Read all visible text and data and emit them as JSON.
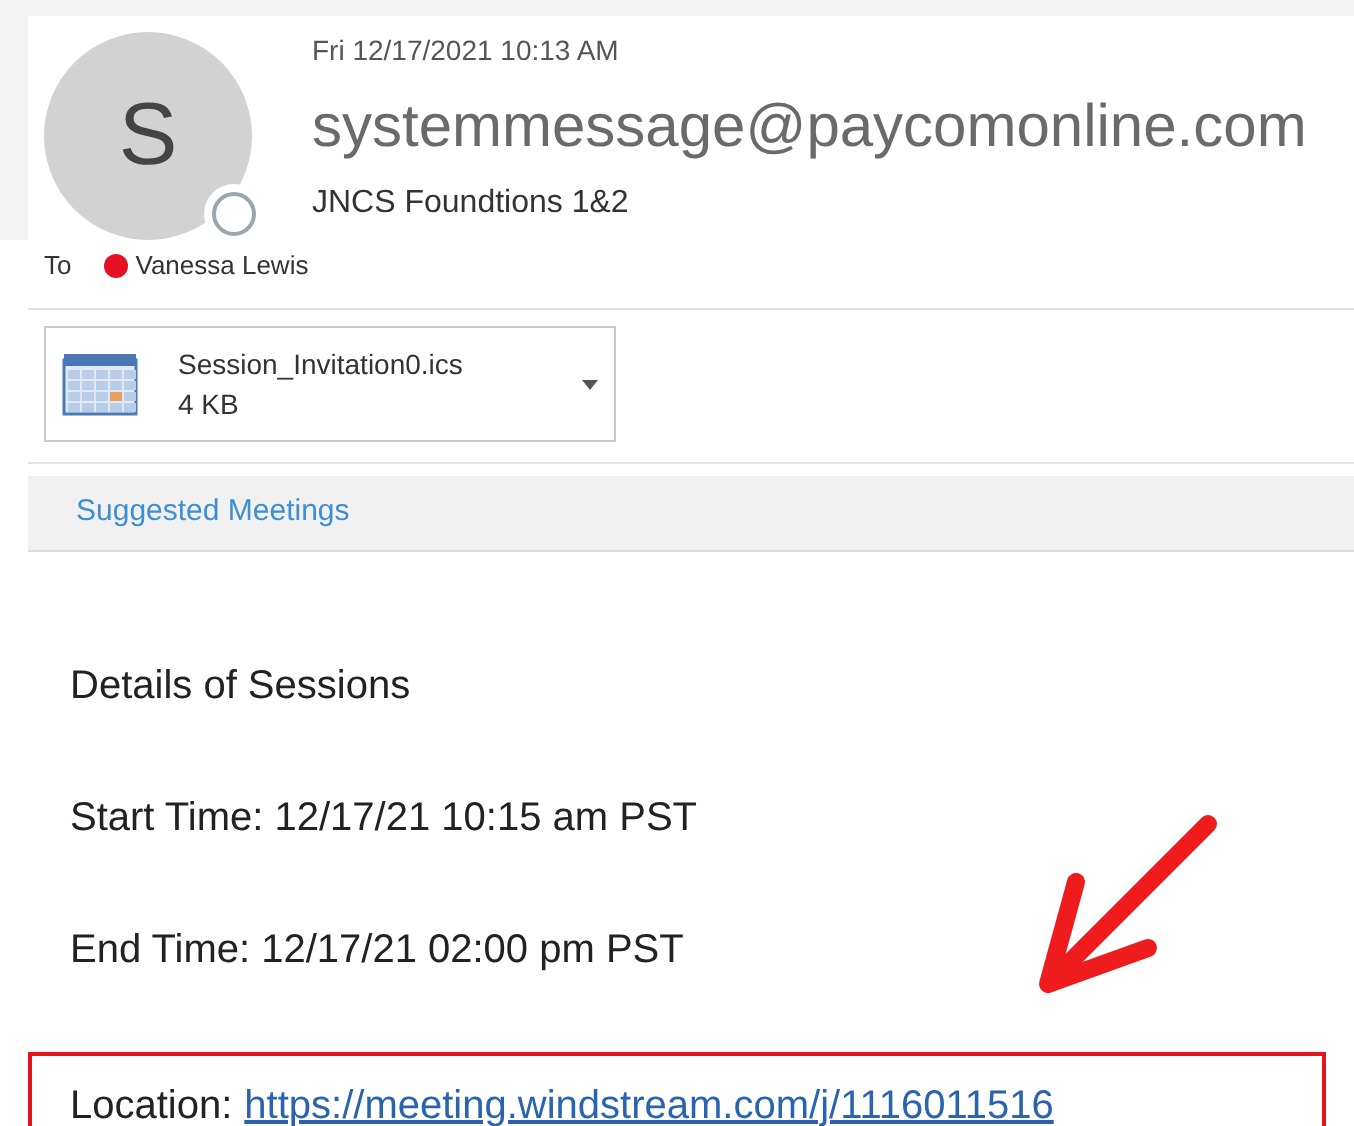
{
  "message": {
    "date": "Fri 12/17/2021 10:13 AM",
    "sender_initial": "S",
    "sender": "systemmessage@paycomonline.com",
    "subject": "JNCS Foundtions 1&2",
    "to_label": "To",
    "recipients": [
      {
        "name": "Vanessa Lewis",
        "color": "#e81123"
      }
    ]
  },
  "attachments": [
    {
      "name": "Session_Invitation0.ics",
      "size": "4 KB"
    }
  ],
  "suggested_meetings": "Suggested Meetings",
  "body": [
    {
      "kind": "text",
      "text": "Details of Sessions",
      "highlighted": false
    },
    {
      "kind": "text",
      "text": "Start Time: 12/17/21 10:15 am PST",
      "highlighted": false
    },
    {
      "kind": "text",
      "text": "End Time: 12/17/21 02:00 pm PST",
      "highlighted": false
    },
    {
      "kind": "link",
      "label": "Location:",
      "link": "https://meeting.windstream.com/j/1116011516",
      "highlighted": true
    }
  ]
}
